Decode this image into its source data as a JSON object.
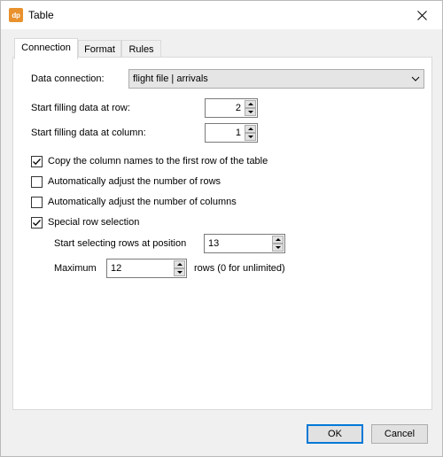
{
  "window": {
    "title": "Table",
    "app_icon_text": "dp",
    "app_icon_color": "#e8912d"
  },
  "tabs": [
    {
      "label": "Connection",
      "active": true
    },
    {
      "label": "Format",
      "active": false
    },
    {
      "label": "Rules",
      "active": false
    }
  ],
  "connection": {
    "data_connection_label": "Data connection:",
    "data_connection_value": "flight file | arrivals",
    "start_row_label": "Start filling data at row:",
    "start_row_value": "2",
    "start_col_label": "Start filling data at column:",
    "start_col_value": "1"
  },
  "checkboxes": [
    {
      "label": "Copy the column names to the first row of the table",
      "checked": true
    },
    {
      "label": "Automatically adjust the number of rows",
      "checked": false
    },
    {
      "label": "Automatically adjust the number of columns",
      "checked": false
    },
    {
      "label": "Special row selection",
      "checked": true
    }
  ],
  "special": {
    "start_position_label": "Start selecting rows at position",
    "start_position_value": "13",
    "maximum_label": "Maximum",
    "maximum_value": "12",
    "maximum_suffix": "rows (0 for unlimited)"
  },
  "buttons": {
    "ok": "OK",
    "cancel": "Cancel"
  }
}
